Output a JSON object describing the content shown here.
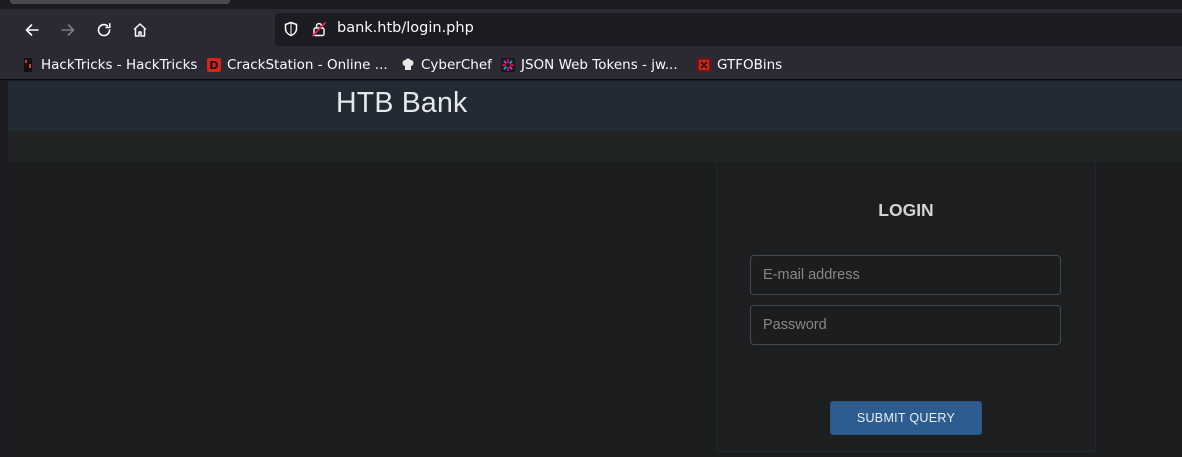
{
  "browser": {
    "url": "bank.htb/login.php",
    "nav_icons": [
      "back-icon",
      "forward-icon",
      "reload-icon",
      "home-icon"
    ],
    "bookmarks": [
      {
        "label": "HackTricks - HackTricks",
        "icon": "hacktricks-favicon"
      },
      {
        "label": "CrackStation - Online ...",
        "icon": "crackstation-favicon"
      },
      {
        "label": "CyberChef",
        "icon": "cyberchef-favicon"
      },
      {
        "label": "JSON Web Tokens - jw...",
        "icon": "jwt-favicon"
      },
      {
        "label": "GTFOBins",
        "icon": "gtfobins-favicon"
      }
    ]
  },
  "site": {
    "title": "HTB Bank"
  },
  "login": {
    "heading": "LOGIN",
    "email_placeholder": "E-mail address",
    "password_placeholder": "Password",
    "submit_label": "SUBMIT QUERY",
    "accent_color": "#2d5d8f"
  }
}
